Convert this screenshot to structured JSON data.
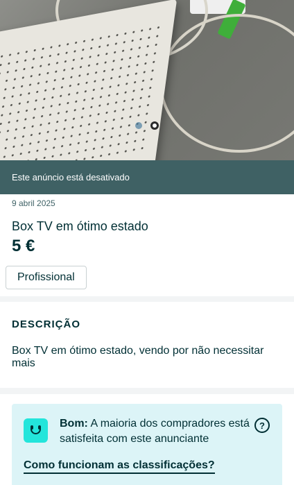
{
  "gallery": {
    "image_alt": "Box TV photo",
    "page_count": 2,
    "active_page": 2
  },
  "banner": {
    "text": "Este anúncio está desativado"
  },
  "listing": {
    "date": "9 abril 2025",
    "title": "Box TV em ótimo estado",
    "price": "5 €",
    "seller_type": "Profissional"
  },
  "description": {
    "heading": "DESCRIÇÃO",
    "text": "Box TV em ótimo estado, vendo por não necessitar mais"
  },
  "rating": {
    "label": "Bom:",
    "text": " A maioria dos compradores está satisfeita com este anunciante",
    "help_icon": "question-circle-icon",
    "link": "Como funcionam as classificações?",
    "accent": "#23e5db",
    "background": "#dcf4f7"
  },
  "colors": {
    "banner": "#3f6164",
    "text": "#002f34"
  }
}
